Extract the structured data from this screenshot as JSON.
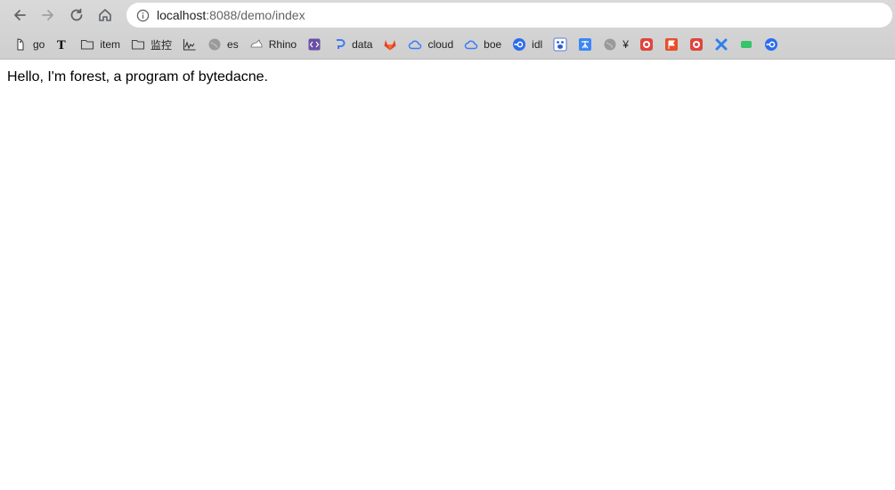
{
  "browser": {
    "url_host": "localhost",
    "url_rest": ":8088/demo/index",
    "bookmarks": [
      {
        "label": "go",
        "icon": "gopher-icon"
      },
      {
        "label": "",
        "icon": "nyt-icon"
      },
      {
        "label": "item",
        "icon": "folder-icon"
      },
      {
        "label": "监控",
        "icon": "folder-icon"
      },
      {
        "label": "",
        "icon": "pulse-chart-icon"
      },
      {
        "label": "es",
        "icon": "globe-icon"
      },
      {
        "label": "Rhino",
        "icon": "rhino-icon"
      },
      {
        "label": "",
        "icon": "code-icon"
      },
      {
        "label": "data",
        "icon": "data-icon"
      },
      {
        "label": "",
        "icon": "gitlab-icon"
      },
      {
        "label": "cloud",
        "icon": "cloud-icon"
      },
      {
        "label": "boe",
        "icon": "cloud-icon"
      },
      {
        "label": "idl",
        "icon": "blue-circle-icon"
      },
      {
        "label": "",
        "icon": "baidu-icon"
      },
      {
        "label": "",
        "icon": "translate-icon"
      },
      {
        "label": "¥",
        "icon": "globe-icon"
      },
      {
        "label": "",
        "icon": "red-app-icon"
      },
      {
        "label": "",
        "icon": "red-flag-icon"
      },
      {
        "label": "",
        "icon": "red-app-icon"
      },
      {
        "label": "",
        "icon": "blue-x-icon"
      },
      {
        "label": "",
        "icon": "green-icon"
      },
      {
        "label": "",
        "icon": "blue-circle-icon"
      }
    ]
  },
  "page": {
    "text": "Hello, I'm forest, a program of bytedacne."
  },
  "colors": {
    "chrome_bg": "#d3d3d3",
    "omnibox_bg": "#ffffff",
    "accent_blue": "#3b7cf5",
    "gitlab_orange": "#e2432a",
    "red_icon": "#e0443e",
    "green_icon": "#35c46a"
  }
}
